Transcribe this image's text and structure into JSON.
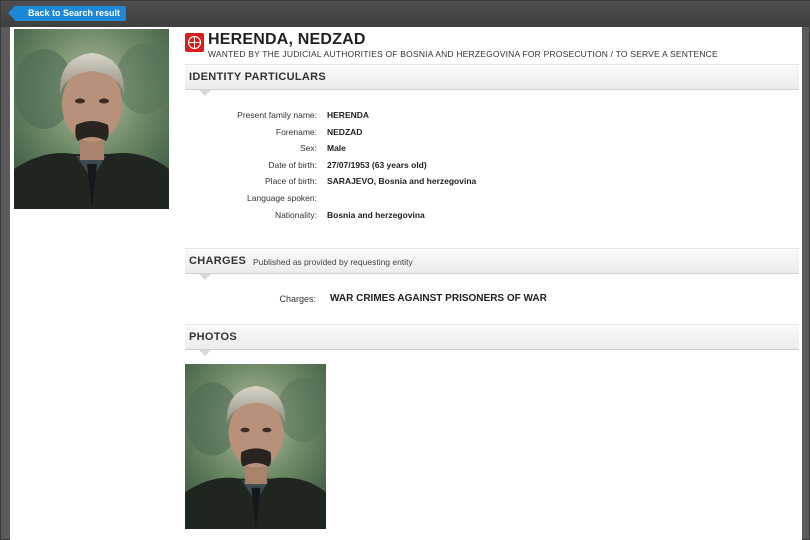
{
  "nav": {
    "back_label": "Back to Search result"
  },
  "notice": {
    "name": "HERENDA, NEDZAD",
    "subtitle": "WANTED BY THE JUDICIAL AUTHORITIES OF BOSNIA AND HERZEGOVINA FOR PROSECUTION / TO SERVE A SENTENCE"
  },
  "identity": {
    "heading": "IDENTITY PARTICULARS",
    "fields": [
      {
        "label": "Present family name:",
        "value": "HERENDA"
      },
      {
        "label": "Forename:",
        "value": "NEDZAD"
      },
      {
        "label": "Sex:",
        "value": "Male"
      },
      {
        "label": "Date of birth:",
        "value": "27/07/1953 (63 years old)"
      },
      {
        "label": "Place of birth:",
        "value": "SARAJEVO, Bosnia and herzegovina"
      },
      {
        "label": "Language spoken:",
        "value": ""
      },
      {
        "label": "Nationality:",
        "value": "Bosnia and herzegovina"
      }
    ]
  },
  "charges": {
    "heading": "CHARGES",
    "subheading": "Published as provided by requesting entity",
    "label": "Charges:",
    "value": "WAR CRIMES AGAINST PRISONERS OF WAR"
  },
  "photos": {
    "heading": "PHOTOS"
  },
  "colors": {
    "accent": "#1e88d8",
    "emblem": "#d61c1c",
    "topbar": "#444444"
  }
}
